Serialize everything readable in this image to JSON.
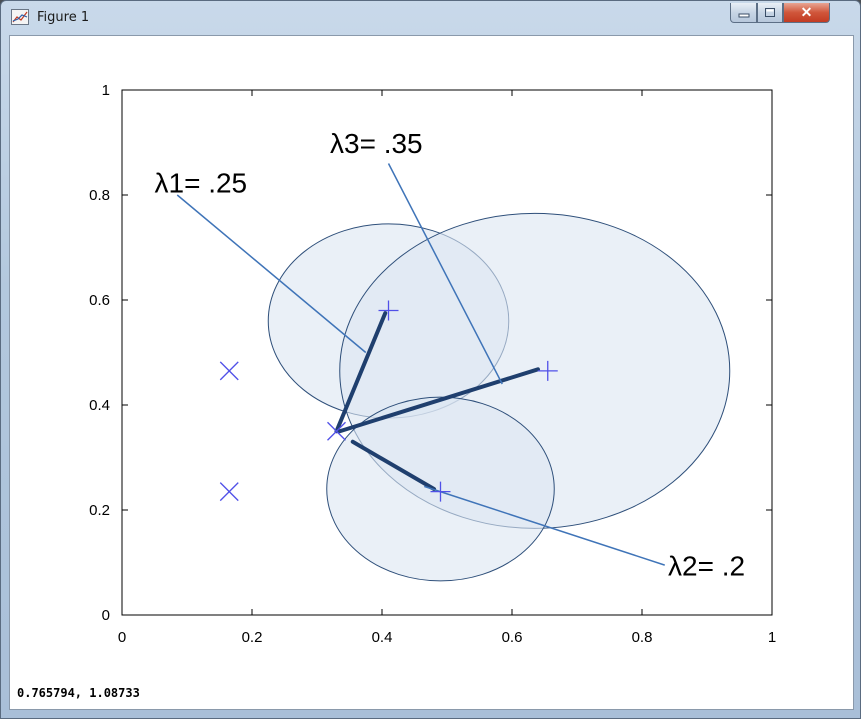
{
  "window": {
    "title": "Figure 1",
    "close_glyph": "✕"
  },
  "status_bar": {
    "coordinates": "0.765794, 1.08733"
  },
  "chart_data": {
    "type": "scatter",
    "xlim": [
      0,
      1
    ],
    "ylim": [
      0,
      1
    ],
    "x_ticks": [
      "0",
      "0.2",
      "0.4",
      "0.6",
      "0.8",
      "1"
    ],
    "y_ticks": [
      "0",
      "0.2",
      "0.4",
      "0.6",
      "0.8",
      "1"
    ],
    "grid": false,
    "x_markers": [
      {
        "x": 0.165,
        "y": 0.465
      },
      {
        "x": 0.165,
        "y": 0.235
      },
      {
        "x": 0.33,
        "y": 0.35
      }
    ],
    "plus_markers": [
      {
        "x": 0.41,
        "y": 0.58
      },
      {
        "x": 0.655,
        "y": 0.465
      },
      {
        "x": 0.49,
        "y": 0.235
      }
    ],
    "circles": [
      {
        "cx": 0.41,
        "cy": 0.56,
        "r": 0.185
      },
      {
        "cx": 0.635,
        "cy": 0.465,
        "r": 0.3
      },
      {
        "cx": 0.49,
        "cy": 0.24,
        "r": 0.175
      }
    ],
    "segments": [
      {
        "x1": 0.33,
        "y1": 0.35,
        "x2": 0.405,
        "y2": 0.575
      },
      {
        "x1": 0.335,
        "y1": 0.35,
        "x2": 0.64,
        "y2": 0.468
      },
      {
        "x1": 0.355,
        "y1": 0.33,
        "x2": 0.48,
        "y2": 0.24
      }
    ],
    "annotations": [
      {
        "text": "λ1= .25",
        "label_x": 0.05,
        "label_y": 0.805,
        "from_x": 0.085,
        "from_y": 0.8,
        "to_x": 0.375,
        "to_y": 0.5
      },
      {
        "text": "λ3= .35",
        "label_x": 0.32,
        "label_y": 0.88,
        "from_x": 0.41,
        "from_y": 0.86,
        "to_x": 0.585,
        "to_y": 0.44
      },
      {
        "text": "λ2= .2",
        "label_x": 0.84,
        "label_y": 0.075,
        "from_x": 0.835,
        "from_y": 0.095,
        "to_x": 0.465,
        "to_y": 0.245
      }
    ],
    "colors": {
      "circle_fill": "#dce6f2",
      "circle_stroke": "#2e4f7a",
      "segment": "#1f3f6e",
      "annotation_line": "#3f74b8",
      "marker": "#5050e8"
    }
  }
}
